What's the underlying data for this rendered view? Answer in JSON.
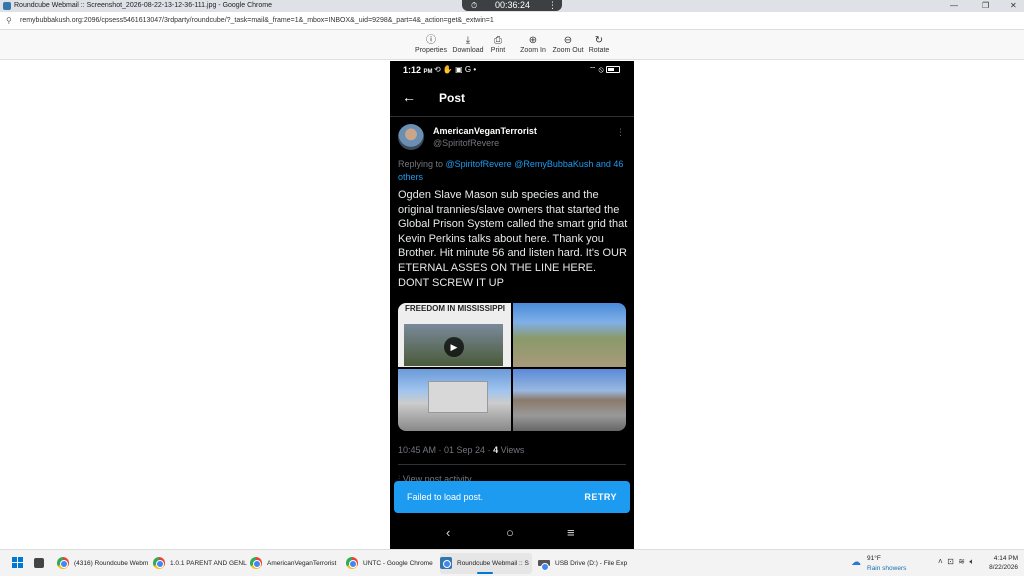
{
  "browser": {
    "window_title": "Roundcube Webmail :: Screenshot_2026-08-22-13-12-36-111.jpg - Google Chrome",
    "url": "remybubbakush.org:2096/cpsess5461613047/3rdparty/roundcube/?_task=mail&_frame=1&_mbox=INBOX&_uid=9298&_part=4&_action=get&_extwin=1",
    "timer": "00:36:24"
  },
  "toolbar": {
    "properties": "Properties",
    "download": "Download",
    "print": "Print",
    "zoom_in": "Zoom In",
    "zoom_out": "Zoom Out",
    "rotate": "Rotate"
  },
  "phone": {
    "status_time": "1:12",
    "status_ampm": "PM",
    "header_title": "Post",
    "author_name": "AmericanVeganTerrorist",
    "author_handle": "@SpiritofRevere",
    "reply_prefix": "Replying to ",
    "reply_links": "@SpiritofRevere @RemyBubbaKush and 46 others",
    "body": "Ogden Slave Mason sub species and the original trannies/slave owners that started the Global Prison System called the smart grid that Kevin Perkins talks about here. Thank you Brother.  Hit minute 56 and listen hard.  It's OUR ETERNAL ASSES ON THE LINE HERE. DONT SCREW IT UP",
    "media_caption": "FREEDOM IN MISSISSIPPI",
    "post_time": "10:45 AM · 01 Sep 24 · ",
    "views_count": "4",
    "views_label": " Views",
    "activity": "View post activity",
    "toast_message": "Failed to load post.",
    "toast_action": "RETRY"
  },
  "taskbar": {
    "tasks": [
      "(4316) Roundcube Webm",
      "1.0.1 PARENT AND GENL",
      "AmericanVeganTerrorist",
      "UNTC - Google Chrome",
      "Roundcube Webmail :: S",
      "USB Drive (D:) - File Exp"
    ],
    "weather_temp": "91°F",
    "weather_desc": "Rain showers",
    "clock_time": "4:14 PM",
    "clock_date": "8/22/2026"
  },
  "colors": {
    "accent": "#1d9bf0",
    "phone_bg": "#000000",
    "muted_text": "#71767b"
  }
}
